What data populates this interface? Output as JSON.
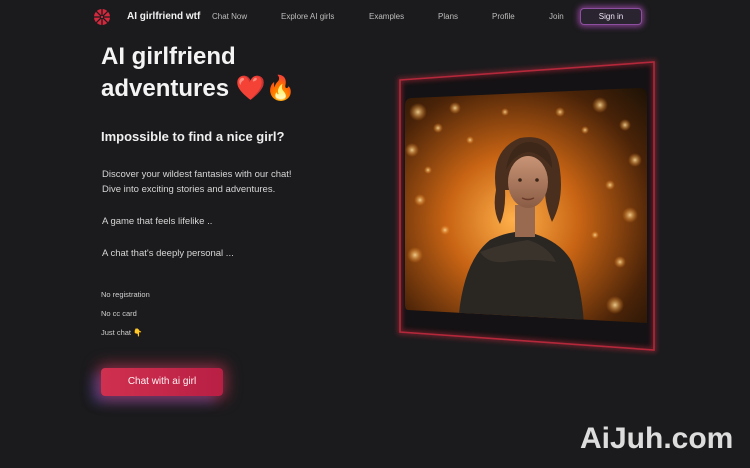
{
  "nav": {
    "brand": "AI girlfriend wtf",
    "links": [
      "Chat Now",
      "Explore AI girls",
      "Examples",
      "Plans",
      "Profile",
      "Join"
    ],
    "signin_label": "Sign in"
  },
  "hero": {
    "title_line1": "AI girlfriend",
    "title_line2": "adventures",
    "title_emojis": "❤️🔥",
    "subtitle": "Impossible to find a nice girl?",
    "paragraph_line1": "Discover your wildest fantasies with our chat!",
    "paragraph_line2": "Dive into exciting stories and adventures.",
    "line_game": "A game that feels lifelike ..",
    "line_chat": "A chat that's deeply personal ...",
    "perks": [
      "No registration",
      "No cc card",
      "Just chat 👇"
    ],
    "cta_label": "Chat with ai girl"
  },
  "watermark": "AiJuh.com",
  "colors": {
    "background": "#1b1b1d",
    "accent": "#d0304f",
    "frame_border": "#c22a3c",
    "signin_glow": "#ce5adc",
    "image_orange": "#e08a2a"
  }
}
